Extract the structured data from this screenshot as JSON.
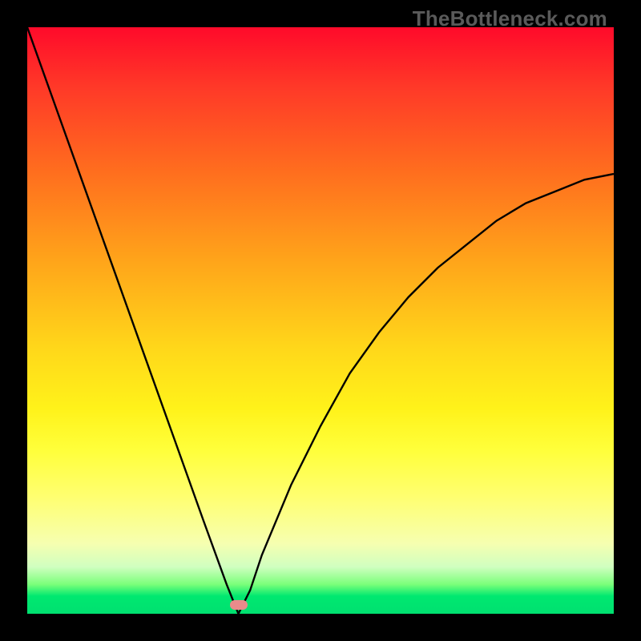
{
  "watermark": "TheBottleneck.com",
  "chart_data": {
    "type": "line",
    "title": "",
    "xlabel": "",
    "ylabel": "",
    "xlim": [
      0,
      100
    ],
    "ylim": [
      0,
      100
    ],
    "series": [
      {
        "name": "curve",
        "x": [
          0,
          5,
          10,
          15,
          20,
          25,
          30,
          34,
          36,
          38,
          40,
          45,
          50,
          55,
          60,
          65,
          70,
          75,
          80,
          85,
          90,
          95,
          100
        ],
        "values": [
          100,
          86,
          72,
          58,
          44,
          30,
          16,
          5,
          0,
          4,
          10,
          22,
          32,
          41,
          48,
          54,
          59,
          63,
          67,
          70,
          72,
          74,
          75
        ]
      }
    ],
    "marker": {
      "x": 36,
      "y": 0
    },
    "background_gradient": {
      "top": "#ff0a2a",
      "mid_upper": "#ffa51a",
      "mid": "#ffff3a",
      "mid_lower": "#d0ffc0",
      "bottom": "#00e070"
    }
  }
}
